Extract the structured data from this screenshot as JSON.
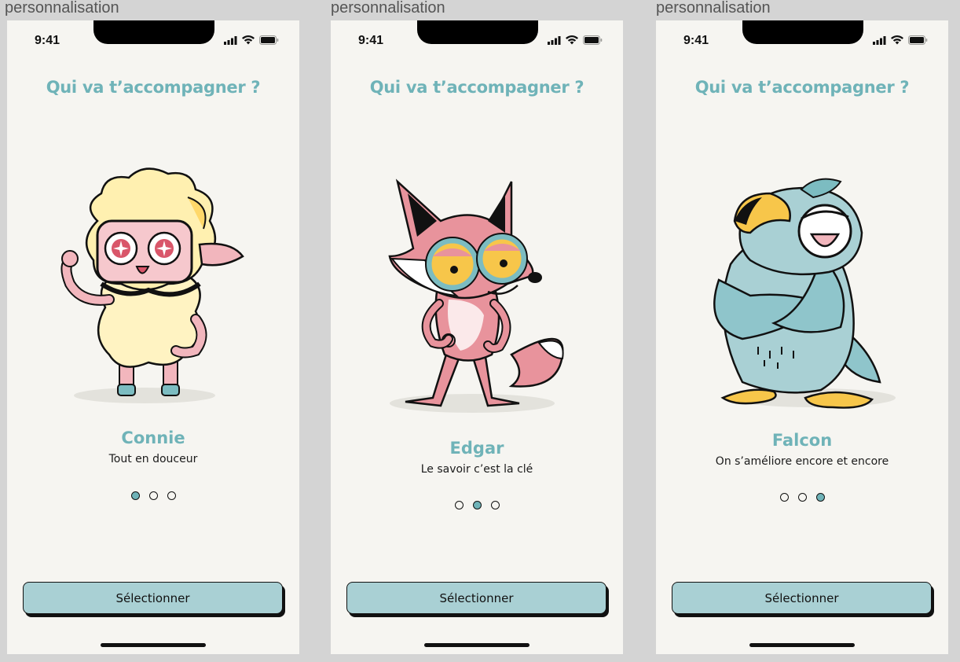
{
  "frame_label": "personnalisation",
  "status_bar": {
    "time": "9:41",
    "icons": [
      "signal-icon",
      "wifi-icon",
      "battery-icon"
    ]
  },
  "heading": "Qui va t’accompagner ?",
  "button_label": "Sélectionner",
  "accent_color": "#6fb3b8",
  "button_color": "#a9d0d4",
  "screens": [
    {
      "name": "Connie",
      "tagline": "Tout en douceur",
      "active_dot": 0,
      "character": "sheep"
    },
    {
      "name": "Edgar",
      "tagline": "Le savoir c’est la clé",
      "active_dot": 1,
      "character": "fox"
    },
    {
      "name": "Falcon",
      "tagline": "On s’améliore encore et encore",
      "active_dot": 2,
      "character": "bird"
    }
  ]
}
